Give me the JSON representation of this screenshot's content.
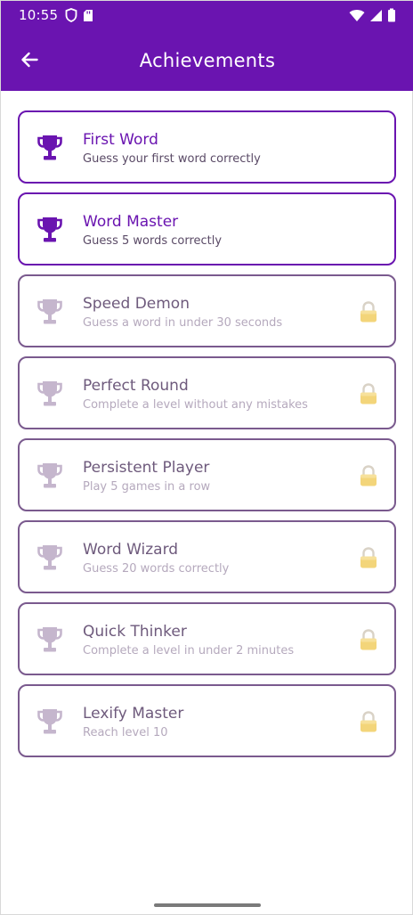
{
  "status": {
    "time": "10:55"
  },
  "header": {
    "title": "Achievements"
  },
  "colors": {
    "primary": "#6a14b0",
    "locked_trophy": "#c5b6cd",
    "lock": "#f3d57a"
  },
  "achievements": [
    {
      "name": "First Word",
      "description": "Guess your first word correctly",
      "locked": false
    },
    {
      "name": "Word Master",
      "description": "Guess 5 words correctly",
      "locked": false
    },
    {
      "name": "Speed Demon",
      "description": "Guess a word in under 30 seconds",
      "locked": true
    },
    {
      "name": "Perfect Round",
      "description": "Complete a level without any mistakes",
      "locked": true
    },
    {
      "name": "Persistent Player",
      "description": "Play 5 games in a row",
      "locked": true
    },
    {
      "name": "Word Wizard",
      "description": "Guess 20 words correctly",
      "locked": true
    },
    {
      "name": "Quick Thinker",
      "description": "Complete a level in under 2 minutes",
      "locked": true
    },
    {
      "name": "Lexify Master",
      "description": "Reach level 10",
      "locked": true
    }
  ]
}
